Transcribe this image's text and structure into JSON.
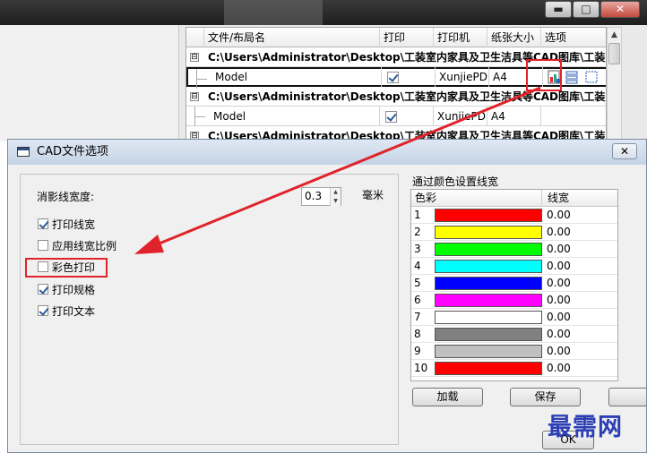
{
  "parent": {
    "window_buttons": {
      "minimize": "▬",
      "maximize": "□",
      "close": "✕"
    },
    "list": {
      "headers": [
        "文件/布局名",
        "打印",
        "打印机",
        "纸张大小",
        "选项"
      ],
      "rows": [
        {
          "kind": "path",
          "tree": "⊟",
          "name": "C:\\Users\\Administrator\\Desktop\\工装室内家具及卫生洁具等CAD图库\\工装室内"
        },
        {
          "kind": "layout",
          "name": "Model",
          "checked": true,
          "printer": "XunjiePDF",
          "paper": "A4",
          "has_option_icons": true
        },
        {
          "kind": "path",
          "tree": "⊟",
          "name": "C:\\Users\\Administrator\\Desktop\\工装室内家具及卫生洁具等CAD图库\\工装室内"
        },
        {
          "kind": "layout",
          "name": "Model",
          "checked": true,
          "printer": "XunjiePDF",
          "paper": "A4",
          "has_option_icons": false
        },
        {
          "kind": "path",
          "tree": "⊟",
          "name": "C:\\Users\\Administrator\\Desktop\\工装室内家具及卫生洁具等CAD图库\\工装室内"
        }
      ]
    }
  },
  "dialog": {
    "title": "CAD文件选项",
    "close_glyph": "✕",
    "hidden_line_label": "消影线宽度:",
    "hidden_line_value": "0.3",
    "unit": "毫米",
    "options": [
      {
        "label": "打印线宽",
        "checked": true
      },
      {
        "label": "应用线宽比例",
        "checked": false
      },
      {
        "label": "彩色打印",
        "checked": false
      },
      {
        "label": "打印规格",
        "checked": true
      },
      {
        "label": "打印文本",
        "checked": true
      }
    ],
    "color_section_title": "通过颜色设置线宽",
    "color_table": {
      "headers": [
        "色彩",
        "线宽"
      ],
      "rows": [
        {
          "index": "1",
          "color": "#ff0000",
          "width": "0.00"
        },
        {
          "index": "2",
          "color": "#ffff00",
          "width": "0.00"
        },
        {
          "index": "3",
          "color": "#00ff00",
          "width": "0.00"
        },
        {
          "index": "4",
          "color": "#00ffff",
          "width": "0.00"
        },
        {
          "index": "5",
          "color": "#0000ff",
          "width": "0.00"
        },
        {
          "index": "6",
          "color": "#ff00ff",
          "width": "0.00"
        },
        {
          "index": "7",
          "color": "#ffffff",
          "width": "0.00"
        },
        {
          "index": "8",
          "color": "#808080",
          "width": "0.00"
        },
        {
          "index": "9",
          "color": "#c0c0c0",
          "width": "0.00"
        },
        {
          "index": "10",
          "color": "#ff0000",
          "width": "0.00"
        }
      ]
    },
    "buttons": {
      "load": "加载",
      "save": "保存",
      "ok": "OK"
    }
  },
  "watermark": "最需网",
  "annotation_color": "#e0232a"
}
